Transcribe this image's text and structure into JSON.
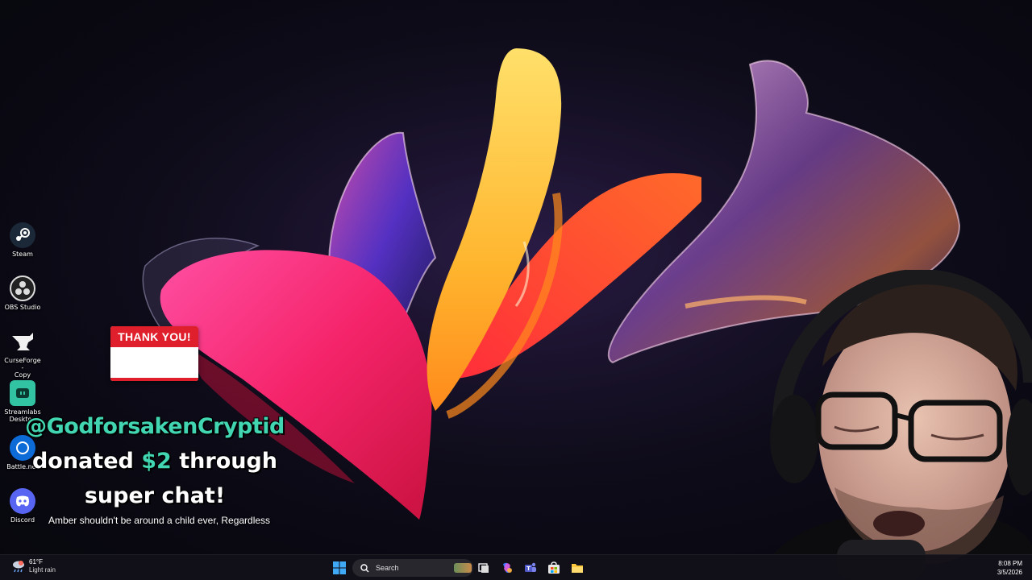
{
  "desktop": {
    "icons": [
      {
        "label": "Steam",
        "icon": "steam-icon"
      },
      {
        "label": "OBS Studio",
        "icon": "obs-icon"
      },
      {
        "label": "CurseForge -\nCopy",
        "icon": "curseforge-icon"
      },
      {
        "label": "Streamlabs\nDesktop",
        "icon": "streamlabs-icon"
      },
      {
        "label": "Battle.net",
        "icon": "battlenet-icon"
      },
      {
        "label": "Discord",
        "icon": "discord-icon"
      }
    ]
  },
  "alert": {
    "banner": "THANK YOU!",
    "username": "@GodforsakenCryptid",
    "donated_word": "donated",
    "amount": "$2",
    "through_word": "through",
    "line2": "super chat!",
    "message": "Amber shouldn't be around a child ever, Regardless",
    "accent_color": "#41d6b1",
    "banner_color": "#e01f2d"
  },
  "taskbar": {
    "weather": {
      "temp": "61°F",
      "condition": "Light rain",
      "icon": "weather-rain-icon"
    },
    "search_placeholder": "Search",
    "pinned": [
      "windows-start-icon",
      "search-icon",
      "task-view-icon",
      "copilot-icon",
      "teams-icon",
      "store-icon",
      "file-explorer-icon"
    ],
    "clock": {
      "time": "8:08 PM",
      "date": "3/5/2026"
    }
  }
}
